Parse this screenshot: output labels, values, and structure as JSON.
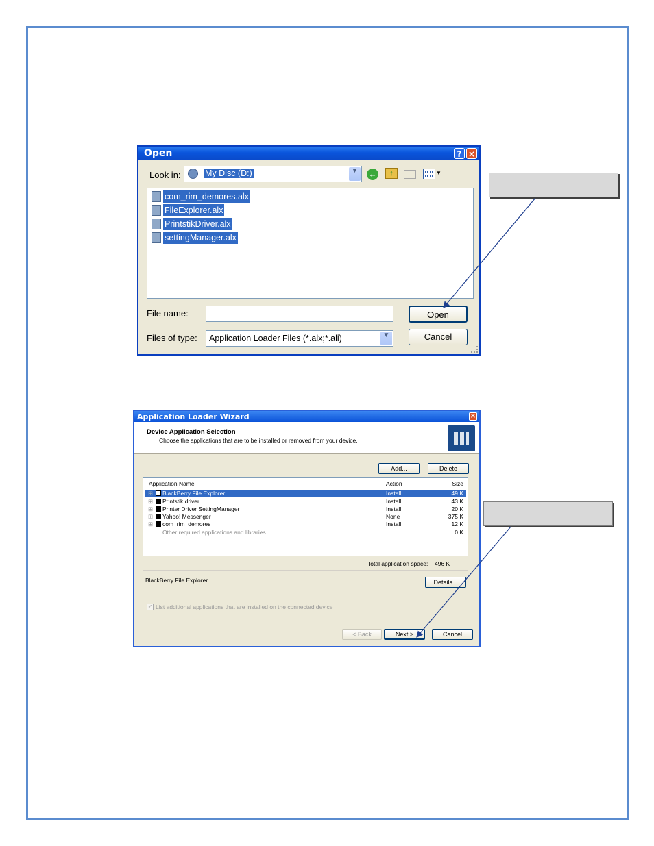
{
  "open_dialog": {
    "title": "Open",
    "help_btn": "?",
    "close_btn": "×",
    "look_in_label": "Look in:",
    "look_in_value": "My Disc (D:)",
    "files": [
      "com_rim_demores.alx",
      "FileExplorer.alx",
      "PrintstikDriver.alx",
      "settingManager.alx"
    ],
    "file_name_label": "File name:",
    "file_name_value": "",
    "files_of_type_label": "Files of type:",
    "files_of_type_value": "Application Loader Files (*.alx;*.ali)",
    "open_button": "Open",
    "cancel_button": "Cancel"
  },
  "wizard": {
    "title": "Application Loader Wizard",
    "close_btn": "×",
    "header_title": "Device Application Selection",
    "header_subtitle": "Choose the applications that are to be installed or removed from your device.",
    "add_button": "Add...",
    "delete_button": "Delete",
    "columns": [
      "Application Name",
      "Action",
      "Size"
    ],
    "rows": [
      {
        "name": "BlackBerry File Explorer",
        "action": "Install",
        "size": "49 K"
      },
      {
        "name": "Printstik driver",
        "action": "Install",
        "size": "43 K"
      },
      {
        "name": "Printer Driver SettingManager",
        "action": "Install",
        "size": "20 K"
      },
      {
        "name": "Yahoo! Messenger",
        "action": "None",
        "size": "375 K"
      },
      {
        "name": "com_rim_demores",
        "action": "Install",
        "size": "12 K"
      }
    ],
    "other_row": {
      "name": "Other required applications and libraries",
      "size": "0 K"
    },
    "total_label": "Total application space:",
    "total_value": "496 K",
    "selected_app": "BlackBerry File Explorer",
    "details_button": "Details...",
    "checkbox_label": "List additional applications that are installed on the connected device",
    "back_button": "< Back",
    "next_button": "Next >",
    "cancel_button": "Cancel"
  },
  "colors": {
    "frame": "#5b8ccf",
    "xp_title": "#0a55dc",
    "selection": "#316ac5",
    "callout": "#d9d9d9"
  }
}
